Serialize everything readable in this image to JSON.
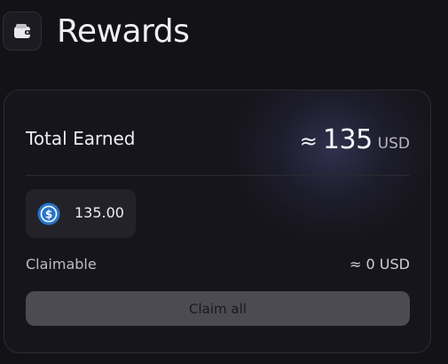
{
  "header": {
    "title": "Rewards",
    "icon": "wallet-icon"
  },
  "card": {
    "total_label": "Total Earned",
    "total_approx": "≈",
    "total_amount": "135",
    "total_unit": "USD",
    "token": {
      "icon": "usdc-icon",
      "icon_color": "#2775ca",
      "amount": "135.00"
    },
    "claimable_label": "Claimable",
    "claimable_value": "≈ 0 USD",
    "claim_button_label": "Claim all"
  }
}
